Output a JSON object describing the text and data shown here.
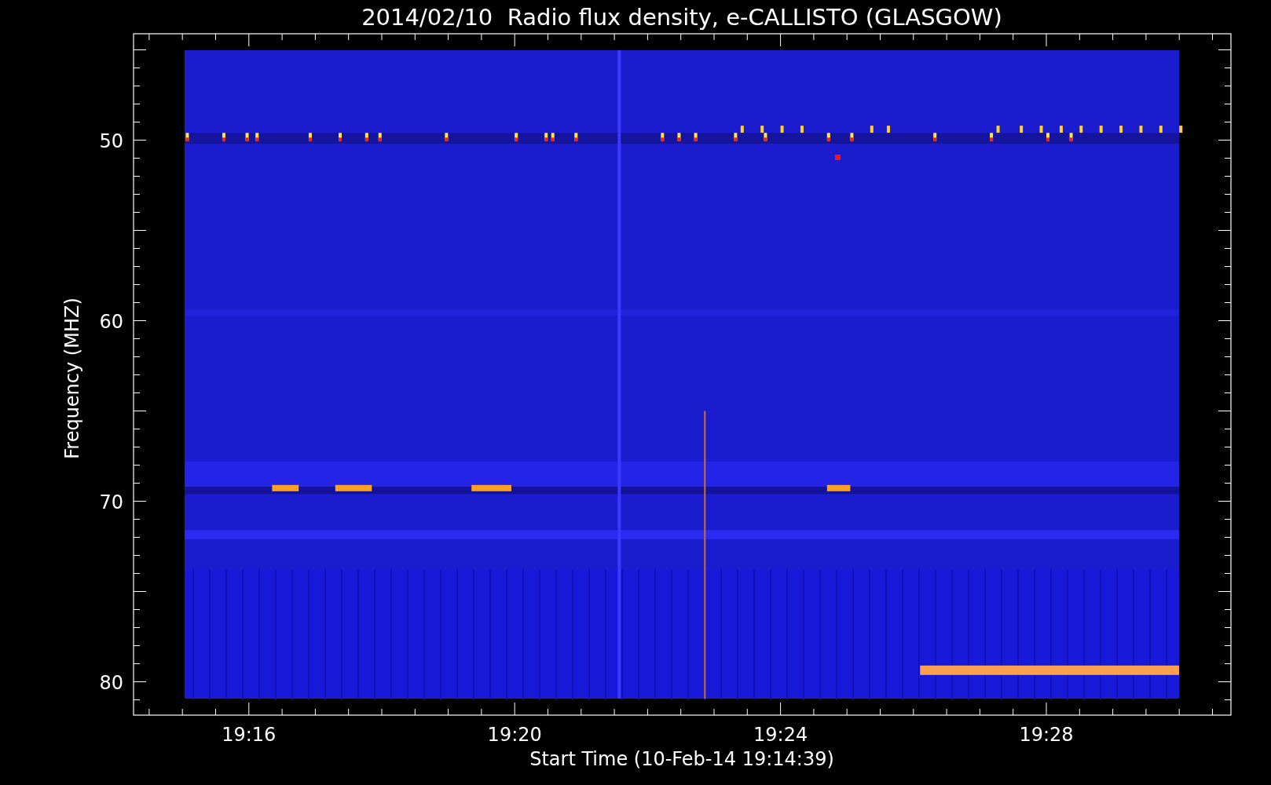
{
  "title": "2014/02/10  Radio flux density, e-CALLISTO (GLASGOW)",
  "ylabel": "Frequency (MHZ)",
  "xlabel": "Start Time (10-Feb-14 19:14:39)",
  "yticks": [
    "50",
    "60",
    "70",
    "80"
  ],
  "xticks": [
    "19:16",
    "19:20",
    "19:24",
    "19:28"
  ]
}
